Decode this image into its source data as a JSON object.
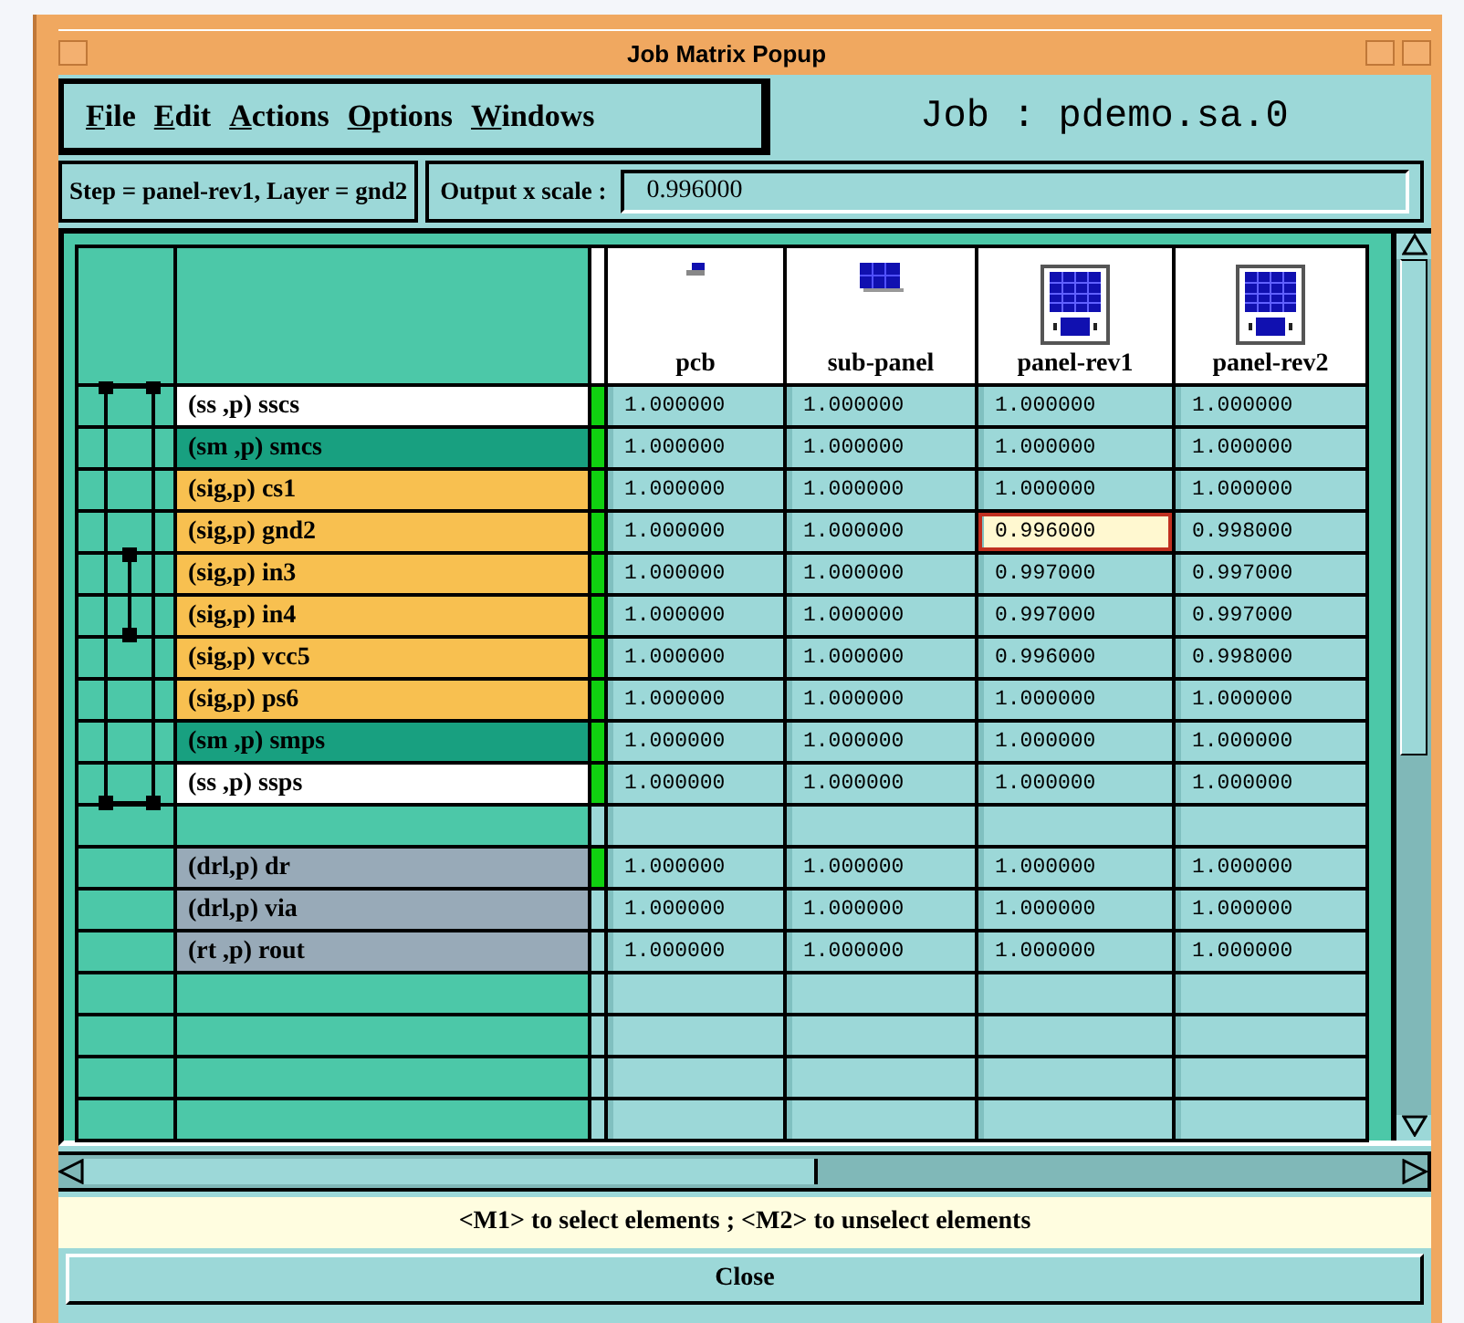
{
  "window": {
    "title": "Job Matrix Popup"
  },
  "menu": [
    "File",
    "Edit",
    "Actions",
    "Options",
    "Windows"
  ],
  "job_label": "Job : pdemo.sa.0",
  "step_info": "Step = panel-rev1, Layer = gnd2",
  "scale": {
    "label": "Output x scale :",
    "value": "0.996000"
  },
  "steps": [
    {
      "name": "pcb",
      "kind": "single"
    },
    {
      "name": "sub-panel",
      "kind": "array"
    },
    {
      "name": "panel-rev1",
      "kind": "panel"
    },
    {
      "name": "panel-rev2",
      "kind": "panel"
    }
  ],
  "rows": [
    {
      "kind": "layer",
      "name": "(ss ,p) sscs",
      "color": "#ffffff",
      "marked": true,
      "cells": [
        {
          "value": "1.000000",
          "selected": false
        },
        {
          "value": "1.000000",
          "selected": false
        },
        {
          "value": "1.000000",
          "selected": false
        },
        {
          "value": "1.000000",
          "selected": false
        }
      ]
    },
    {
      "kind": "layer",
      "name": "(sm ,p) smcs",
      "color": "#18a080",
      "marked": true,
      "cells": [
        {
          "value": "1.000000",
          "selected": false
        },
        {
          "value": "1.000000",
          "selected": false
        },
        {
          "value": "1.000000",
          "selected": false
        },
        {
          "value": "1.000000",
          "selected": false
        }
      ]
    },
    {
      "kind": "layer",
      "name": "(sig,p) cs1",
      "color": "#f8c050",
      "marked": true,
      "cells": [
        {
          "value": "1.000000",
          "selected": false
        },
        {
          "value": "1.000000",
          "selected": false
        },
        {
          "value": "1.000000",
          "selected": false
        },
        {
          "value": "1.000000",
          "selected": false
        }
      ]
    },
    {
      "kind": "layer",
      "name": "(sig,p) gnd2",
      "color": "#f8c050",
      "marked": true,
      "cells": [
        {
          "value": "1.000000",
          "selected": false
        },
        {
          "value": "1.000000",
          "selected": false
        },
        {
          "value": "0.996000",
          "selected": true
        },
        {
          "value": "0.998000",
          "selected": false
        }
      ]
    },
    {
      "kind": "layer",
      "name": "(sig,p) in3",
      "color": "#f8c050",
      "marked": true,
      "cells": [
        {
          "value": "1.000000",
          "selected": false
        },
        {
          "value": "1.000000",
          "selected": false
        },
        {
          "value": "0.997000",
          "selected": false
        },
        {
          "value": "0.997000",
          "selected": false
        }
      ]
    },
    {
      "kind": "layer",
      "name": "(sig,p) in4",
      "color": "#f8c050",
      "marked": true,
      "cells": [
        {
          "value": "1.000000",
          "selected": false
        },
        {
          "value": "1.000000",
          "selected": false
        },
        {
          "value": "0.997000",
          "selected": false
        },
        {
          "value": "0.997000",
          "selected": false
        }
      ]
    },
    {
      "kind": "layer",
      "name": "(sig,p) vcc5",
      "color": "#f8c050",
      "marked": true,
      "cells": [
        {
          "value": "1.000000",
          "selected": false
        },
        {
          "value": "1.000000",
          "selected": false
        },
        {
          "value": "0.996000",
          "selected": false
        },
        {
          "value": "0.998000",
          "selected": false
        }
      ]
    },
    {
      "kind": "layer",
      "name": "(sig,p) ps6",
      "color": "#f8c050",
      "marked": true,
      "cells": [
        {
          "value": "1.000000",
          "selected": false
        },
        {
          "value": "1.000000",
          "selected": false
        },
        {
          "value": "1.000000",
          "selected": false
        },
        {
          "value": "1.000000",
          "selected": false
        }
      ]
    },
    {
      "kind": "layer",
      "name": "(sm ,p) smps",
      "color": "#18a080",
      "marked": true,
      "cells": [
        {
          "value": "1.000000",
          "selected": false
        },
        {
          "value": "1.000000",
          "selected": false
        },
        {
          "value": "1.000000",
          "selected": false
        },
        {
          "value": "1.000000",
          "selected": false
        }
      ]
    },
    {
      "kind": "layer",
      "name": "(ss ,p) ssps",
      "color": "#ffffff",
      "marked": true,
      "cells": [
        {
          "value": "1.000000",
          "selected": false
        },
        {
          "value": "1.000000",
          "selected": false
        },
        {
          "value": "1.000000",
          "selected": false
        },
        {
          "value": "1.000000",
          "selected": false
        }
      ]
    },
    {
      "kind": "empty"
    },
    {
      "kind": "layer",
      "name": "(drl,p) dr",
      "color": "#98aab8",
      "marked": true,
      "cells": [
        {
          "value": "1.000000",
          "selected": false
        },
        {
          "value": "1.000000",
          "selected": false
        },
        {
          "value": "1.000000",
          "selected": false
        },
        {
          "value": "1.000000",
          "selected": false
        }
      ]
    },
    {
      "kind": "layer",
      "name": "(drl,p) via",
      "color": "#98aab8",
      "marked": false,
      "cells": [
        {
          "value": "1.000000",
          "selected": false
        },
        {
          "value": "1.000000",
          "selected": false
        },
        {
          "value": "1.000000",
          "selected": false
        },
        {
          "value": "1.000000",
          "selected": false
        }
      ]
    },
    {
      "kind": "layer",
      "name": "(rt ,p) rout",
      "color": "#98aab8",
      "marked": false,
      "cells": [
        {
          "value": "1.000000",
          "selected": false
        },
        {
          "value": "1.000000",
          "selected": false
        },
        {
          "value": "1.000000",
          "selected": false
        },
        {
          "value": "1.000000",
          "selected": false
        }
      ]
    },
    {
      "kind": "empty"
    },
    {
      "kind": "empty"
    },
    {
      "kind": "empty"
    },
    {
      "kind": "empty"
    }
  ],
  "status": "<M1> to select elements ; <M2> to unselect elements",
  "buttons": [
    "Close"
  ]
}
